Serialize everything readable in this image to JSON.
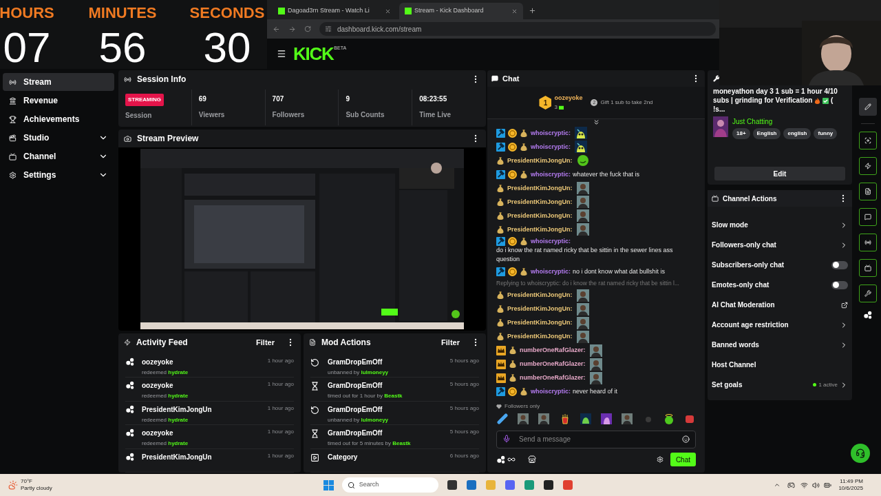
{
  "browser": {
    "tabs": [
      {
        "title": "Dagoad3rn Stream - Watch Li",
        "selected": false
      },
      {
        "title": "Stream - Kick Dashboard",
        "selected": true
      }
    ],
    "address": "dashboard.kick.com/stream"
  },
  "timer": [
    {
      "label": "HOURS",
      "value": "07"
    },
    {
      "label": "MINUTES",
      "value": "56"
    },
    {
      "label": "SECONDS",
      "value": "30"
    }
  ],
  "logo": {
    "text": "KICK",
    "badge": "BETA"
  },
  "sidebar": [
    {
      "label": "Stream",
      "selected": true,
      "expandable": false
    },
    {
      "label": "Revenue",
      "selected": false,
      "expandable": false
    },
    {
      "label": "Achievements",
      "selected": false,
      "expandable": false
    },
    {
      "label": "Studio",
      "selected": false,
      "expandable": true
    },
    {
      "label": "Channel",
      "selected": false,
      "expandable": true
    },
    {
      "label": "Settings",
      "selected": false,
      "expandable": true
    }
  ],
  "session": {
    "title": "Session Info",
    "status": "STREAMING",
    "status_label": "Session",
    "stats": [
      {
        "value": "69",
        "label": "Viewers"
      },
      {
        "value": "707",
        "label": "Followers"
      },
      {
        "value": "9",
        "label": "Sub Counts"
      },
      {
        "value": "08:23:55",
        "label": "Time Live"
      }
    ]
  },
  "preview": {
    "title": "Stream Preview"
  },
  "activity": {
    "title": "Activity Feed",
    "filter": "Filter",
    "items": [
      {
        "user": "oozeyoke",
        "action": "redeemed",
        "reward": "hydrate",
        "time": "1 hour ago"
      },
      {
        "user": "oozeyoke",
        "action": "redeemed",
        "reward": "hydrate",
        "time": "1 hour ago"
      },
      {
        "user": "PresidentKimJongUn",
        "action": "redeemed",
        "reward": "hydrate",
        "time": "1 hour ago"
      },
      {
        "user": "oozeyoke",
        "action": "redeemed",
        "reward": "hydrate",
        "time": "1 hour ago"
      },
      {
        "user": "PresidentKimJongUn",
        "time": "1 hour ago"
      }
    ]
  },
  "mod_actions": {
    "title": "Mod Actions",
    "filter": "Filter",
    "items": [
      {
        "kind": "unban",
        "user": "GramDropEmOff",
        "action": "unbanned by",
        "by": "lulmoneyy",
        "time": "5 hours ago"
      },
      {
        "kind": "timeout",
        "user": "GramDropEmOff",
        "action": "timed out for 1 hour by",
        "by": "Beastk",
        "time": "5 hours ago"
      },
      {
        "kind": "unban",
        "user": "GramDropEmOff",
        "action": "unbanned by",
        "by": "lulmoneyy",
        "time": "5 hours ago"
      },
      {
        "kind": "timeout",
        "user": "GramDropEmOff",
        "action": "timed out for 5 minutes by",
        "by": "Beastk",
        "time": "5 hours ago"
      },
      {
        "kind": "category",
        "user": "Category",
        "time": "6 hours ago"
      }
    ]
  },
  "chat": {
    "title": "Chat",
    "leader": {
      "rank": "1",
      "user": "oozeyoke",
      "count": "3"
    },
    "next": {
      "rank": "2",
      "text": "Gift 1 sub to take 2nd"
    },
    "messages": [
      {
        "kind": "message",
        "badges": [
          {
            "kind": "mod"
          },
          {
            "kind": "sub"
          },
          {
            "kind": "gift"
          }
        ],
        "user": "whoiscryptic:",
        "color": "#b57cf2",
        "emote": {
          "kind": "creature"
        }
      },
      {
        "kind": "message",
        "badges": [
          {
            "kind": "mod"
          },
          {
            "kind": "sub"
          },
          {
            "kind": "gift"
          }
        ],
        "user": "whoiscryptic:",
        "color": "#b57cf2",
        "emote": {
          "kind": "creature"
        }
      },
      {
        "kind": "message",
        "badges": [
          {
            "kind": "gift"
          }
        ],
        "user": "PresidentKimJongUn:",
        "color": "#ecc878",
        "emote": {
          "kind": "blob"
        }
      },
      {
        "kind": "message",
        "badges": [
          {
            "kind": "mod"
          },
          {
            "kind": "sub"
          },
          {
            "kind": "gift"
          }
        ],
        "user": "whoiscryptic:",
        "color": "#b57cf2",
        "text": "whatever the fuck that is"
      },
      {
        "kind": "message",
        "badges": [
          {
            "kind": "gift"
          }
        ],
        "user": "PresidentKimJongUn:",
        "color": "#ecc878",
        "emote": {
          "kind": "portrait"
        }
      },
      {
        "kind": "message",
        "badges": [
          {
            "kind": "gift"
          }
        ],
        "user": "PresidentKimJongUn:",
        "color": "#ecc878",
        "emote": {
          "kind": "portrait"
        }
      },
      {
        "kind": "message",
        "badges": [
          {
            "kind": "gift"
          }
        ],
        "user": "PresidentKimJongUn:",
        "color": "#ecc878",
        "emote": {
          "kind": "portrait"
        }
      },
      {
        "kind": "message",
        "badges": [
          {
            "kind": "gift"
          }
        ],
        "user": "PresidentKimJongUn:",
        "color": "#ecc878",
        "emote": {
          "kind": "portrait"
        }
      },
      {
        "kind": "message",
        "badges": [
          {
            "kind": "mod"
          },
          {
            "kind": "sub"
          },
          {
            "kind": "gift"
          }
        ],
        "user": "whoiscryptic:",
        "color": "#b57cf2",
        "text": "do i know the rat named ricky that be sittin in the sewer lines ass question"
      },
      {
        "kind": "message",
        "badges": [
          {
            "kind": "mod"
          },
          {
            "kind": "sub"
          },
          {
            "kind": "gift"
          }
        ],
        "user": "whoiscryptic:",
        "color": "#b57cf2",
        "text": "no i dont know what dat bullshit is"
      },
      {
        "kind": "reply",
        "text": "Replying to whoiscryptic: do i know the rat named ricky that be sittin l..."
      },
      {
        "kind": "message",
        "badges": [
          {
            "kind": "gift"
          }
        ],
        "user": "PresidentKimJongUn:",
        "color": "#ecc878",
        "emote": {
          "kind": "portrait"
        }
      },
      {
        "kind": "message",
        "badges": [
          {
            "kind": "gift"
          }
        ],
        "user": "PresidentKimJongUn:",
        "color": "#ecc878",
        "emote": {
          "kind": "portrait"
        }
      },
      {
        "kind": "message",
        "badges": [
          {
            "kind": "gift"
          }
        ],
        "user": "PresidentKimJongUn:",
        "color": "#ecc878",
        "emote": {
          "kind": "portrait"
        }
      },
      {
        "kind": "message",
        "badges": [
          {
            "kind": "gift"
          }
        ],
        "user": "PresidentKimJongUn:",
        "color": "#ecc878",
        "emote": {
          "kind": "portrait"
        }
      },
      {
        "kind": "message",
        "badges": [
          {
            "kind": "crown"
          },
          {
            "kind": "gift"
          }
        ],
        "user": "numberOneRafGlazer:",
        "color": "#e8a9c9",
        "emote": {
          "kind": "portrait"
        }
      },
      {
        "kind": "message",
        "badges": [
          {
            "kind": "crown"
          },
          {
            "kind": "gift"
          }
        ],
        "user": "numberOneRafGlazer:",
        "color": "#e8a9c9",
        "emote": {
          "kind": "portrait"
        }
      },
      {
        "kind": "message",
        "badges": [
          {
            "kind": "crown"
          },
          {
            "kind": "gift"
          }
        ],
        "user": "numberOneRafGlazer:",
        "color": "#e8a9c9",
        "emote": {
          "kind": "portrait"
        }
      },
      {
        "kind": "message",
        "badges": [
          {
            "kind": "mod"
          },
          {
            "kind": "sub"
          },
          {
            "kind": "gift"
          }
        ],
        "user": "whoiscryptic:",
        "color": "#b57cf2",
        "text": "never heard of it"
      }
    ],
    "mode": "Followers only",
    "placeholder": "Send a message",
    "send": "Chat"
  },
  "stream_info": {
    "title": "moneyathon day 3 1 sub = 1 hour 4/10 subs | grinding for Verification",
    "title_tail": "( !s...",
    "category": "Just Chatting",
    "tags": [
      "18+",
      "English",
      "english",
      "funny"
    ],
    "edit": "Edit"
  },
  "channel_actions": {
    "title": "Channel Actions",
    "items": [
      {
        "label": "Slow mode",
        "kind": "link"
      },
      {
        "label": "Followers-only chat",
        "kind": "link"
      },
      {
        "label": "Subscribers-only chat",
        "kind": "toggle",
        "on": false
      },
      {
        "label": "Emotes-only chat",
        "kind": "toggle",
        "on": false
      },
      {
        "label": "AI Chat Moderation",
        "kind": "external"
      },
      {
        "label": "Account age restriction",
        "kind": "link"
      },
      {
        "label": "Banned words",
        "kind": "link"
      },
      {
        "label": "Host Channel",
        "kind": "plain"
      },
      {
        "label": "Set goals",
        "kind": "goal",
        "status": "1 active"
      }
    ]
  },
  "taskbar": {
    "temperature": "70°F",
    "weather": "Partly cloudy",
    "search": "Search",
    "time": "11:49 PM",
    "date": "10/6/2025"
  }
}
